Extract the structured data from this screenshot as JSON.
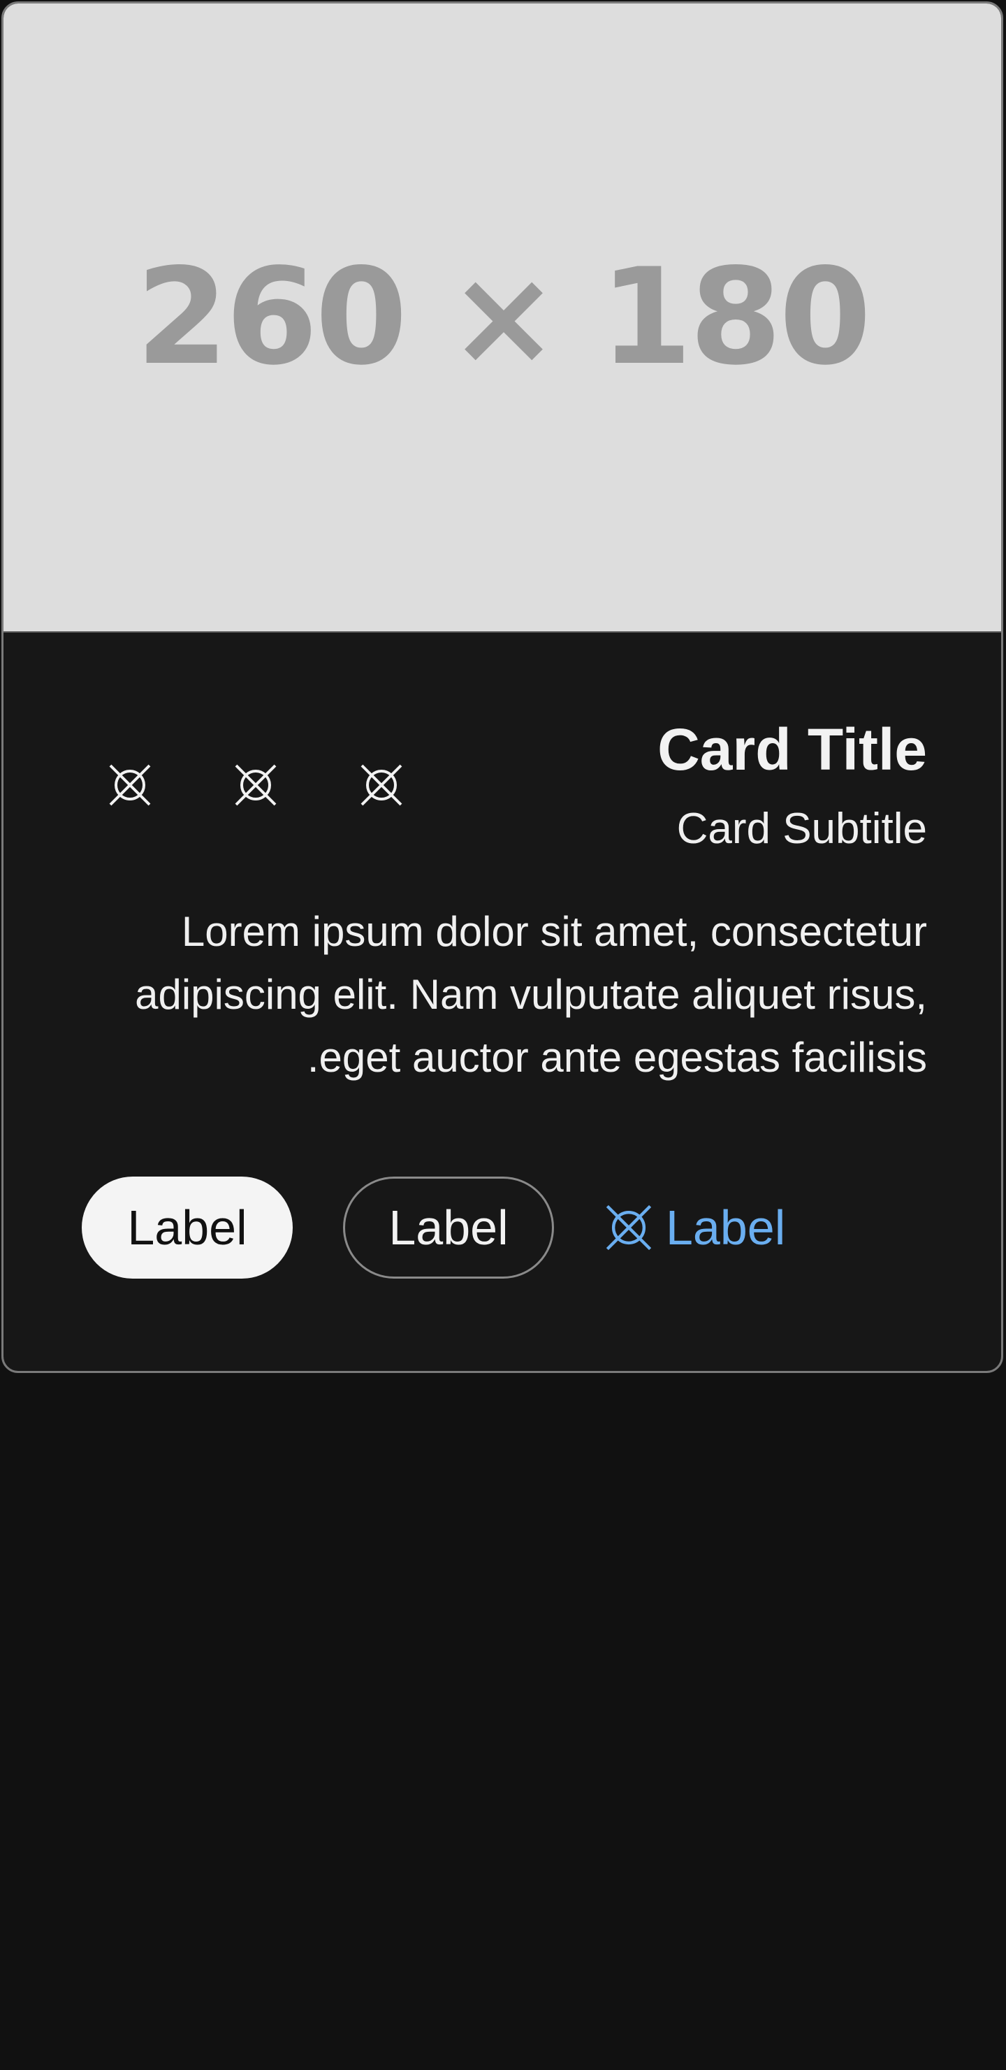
{
  "card": {
    "media_placeholder": "260 × 180",
    "title": "Card Title",
    "subtitle": "Card Subtitle",
    "body": "Lorem ipsum dolor sit amet, consectetur adipiscing elit. Nam vulputate aliquet risus, eget auctor ante egestas facilisis.",
    "icon_buttons": [
      {
        "icon": "placeholder-icon"
      },
      {
        "icon": "placeholder-icon"
      },
      {
        "icon": "placeholder-icon"
      }
    ],
    "actions": {
      "filled_label": "Label",
      "outlined_label": "Label",
      "text_label": "Label",
      "text_icon": "placeholder-icon"
    }
  },
  "colors": {
    "page_background": "#111111",
    "card_background": "#171717",
    "media_background": "#dddddd",
    "accent": "#6aaef0"
  }
}
